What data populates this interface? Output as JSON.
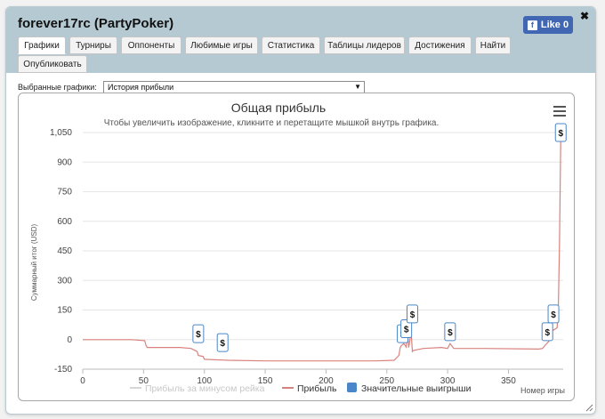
{
  "window": {
    "title": "forever17rc (PartyPoker)",
    "like_label": "Like 0",
    "close_glyph": "✖"
  },
  "tabs": [
    {
      "label": "Графики",
      "active": true
    },
    {
      "label": "Турниры",
      "active": false
    },
    {
      "label": "Оппоненты",
      "active": false
    },
    {
      "label": "Любимые игры",
      "active": false
    },
    {
      "label": "Статистика",
      "active": false
    },
    {
      "label": "Таблицы лидеров",
      "active": false
    },
    {
      "label": "Достижения",
      "active": false
    },
    {
      "label": "Найти",
      "active": false
    },
    {
      "label": "Опубликовать",
      "active": false
    }
  ],
  "graph_select": {
    "label": "Выбранные графики:",
    "value": "История прибыли"
  },
  "colors": {
    "header_bg": "#b5c9d2",
    "profit_line": "#d9827d",
    "no_rake_line": "#d6d6d6",
    "big_win_marker": "#4a86c8",
    "fb_blue": "#4267b2"
  },
  "chart_data": {
    "type": "line",
    "title": "Общая прибыль",
    "subtitle": "Чтобы увеличить изображение, кликните и перетащите мышкой внутрь графика.",
    "xlabel": "Номер игры",
    "ylabel": "Суммарный итог (USD)",
    "xlim": [
      0,
      395
    ],
    "ylim": [
      -150,
      1050
    ],
    "xticks": [
      0,
      50,
      100,
      150,
      200,
      250,
      300,
      350
    ],
    "yticks": [
      -150,
      0,
      150,
      300,
      450,
      600,
      750,
      900,
      1050
    ],
    "ytick_labels": [
      "-150",
      "0",
      "150",
      "300",
      "450",
      "600",
      "750",
      "900",
      "1,050"
    ],
    "legend": [
      "Прибыль за минусом рейка",
      "Прибыль",
      "Значительные выигрыши"
    ],
    "legend_position": "bottom",
    "series": [
      {
        "name": "Прибыль",
        "x": [
          0,
          40,
          51,
          52,
          53,
          80,
          89,
          94,
          95,
          96,
          99,
          100,
          120,
          150,
          200,
          240,
          256,
          260,
          261,
          262,
          264,
          266,
          267,
          268,
          270,
          271,
          272,
          280,
          295,
          300,
          302,
          305,
          330,
          375,
          378,
          380,
          383,
          385,
          390,
          391,
          392,
          393
        ],
        "y": [
          0,
          0,
          -5,
          -30,
          -40,
          -40,
          -45,
          -60,
          -80,
          -82,
          -85,
          -100,
          -105,
          -108,
          -108,
          -108,
          -105,
          -80,
          -40,
          -30,
          -20,
          -38,
          30,
          -40,
          40,
          -60,
          -55,
          -45,
          -40,
          -45,
          -20,
          -45,
          -45,
          -48,
          -45,
          -30,
          -10,
          40,
          60,
          150,
          500,
          1040
        ]
      },
      {
        "name": "Прибыль за минусом рейка",
        "x": [],
        "y": []
      }
    ],
    "big_wins": [
      {
        "x": 95,
        "y": 30
      },
      {
        "x": 115,
        "y": -15
      },
      {
        "x": 263,
        "y": 30
      },
      {
        "x": 266,
        "y": 55
      },
      {
        "x": 271,
        "y": 130
      },
      {
        "x": 302,
        "y": 40
      },
      {
        "x": 382,
        "y": 40
      },
      {
        "x": 387,
        "y": 130
      },
      {
        "x": 393,
        "y": 1050
      }
    ],
    "big_win_symbol": "$"
  }
}
